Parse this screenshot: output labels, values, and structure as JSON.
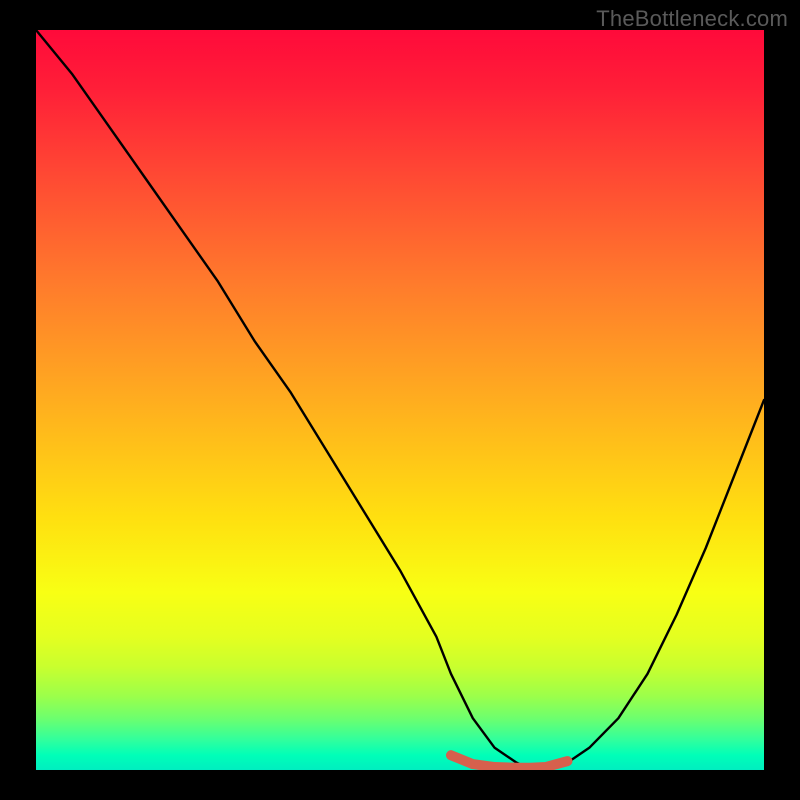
{
  "watermark": "TheBottleneck.com",
  "chart_data": {
    "type": "line",
    "title": "",
    "xlabel": "",
    "ylabel": "",
    "xlim": [
      0,
      100
    ],
    "ylim": [
      0,
      100
    ],
    "series": [
      {
        "name": "bottleneck-curve",
        "x": [
          0,
          5,
          10,
          15,
          20,
          25,
          30,
          35,
          40,
          45,
          50,
          55,
          57,
          60,
          63,
          66,
          68,
          70,
          73,
          76,
          80,
          84,
          88,
          92,
          96,
          100
        ],
        "y": [
          100,
          94,
          87,
          80,
          73,
          66,
          58,
          51,
          43,
          35,
          27,
          18,
          13,
          7,
          3,
          1,
          0,
          0,
          1,
          3,
          7,
          13,
          21,
          30,
          40,
          50
        ]
      },
      {
        "name": "highlighted-optimal-range",
        "x": [
          57,
          60,
          63,
          66,
          68,
          70,
          73
        ],
        "y": [
          2,
          0.8,
          0.4,
          0.3,
          0.3,
          0.4,
          1.2
        ]
      }
    ],
    "gradient_stops": [
      {
        "pos": 0.0,
        "color": "#ff0a3a"
      },
      {
        "pos": 0.08,
        "color": "#ff1f38"
      },
      {
        "pos": 0.2,
        "color": "#ff4a33"
      },
      {
        "pos": 0.34,
        "color": "#ff7a2c"
      },
      {
        "pos": 0.5,
        "color": "#ffad1f"
      },
      {
        "pos": 0.66,
        "color": "#ffe010"
      },
      {
        "pos": 0.76,
        "color": "#f8ff14"
      },
      {
        "pos": 0.82,
        "color": "#e4ff20"
      },
      {
        "pos": 0.86,
        "color": "#c9ff2e"
      },
      {
        "pos": 0.9,
        "color": "#9cff4a"
      },
      {
        "pos": 0.93,
        "color": "#6dff6e"
      },
      {
        "pos": 0.96,
        "color": "#2fff9e"
      },
      {
        "pos": 0.98,
        "color": "#00ffb8"
      },
      {
        "pos": 1.0,
        "color": "#00eec0"
      }
    ],
    "highlight_color": "#d6604d",
    "curve_color": "#000000"
  }
}
